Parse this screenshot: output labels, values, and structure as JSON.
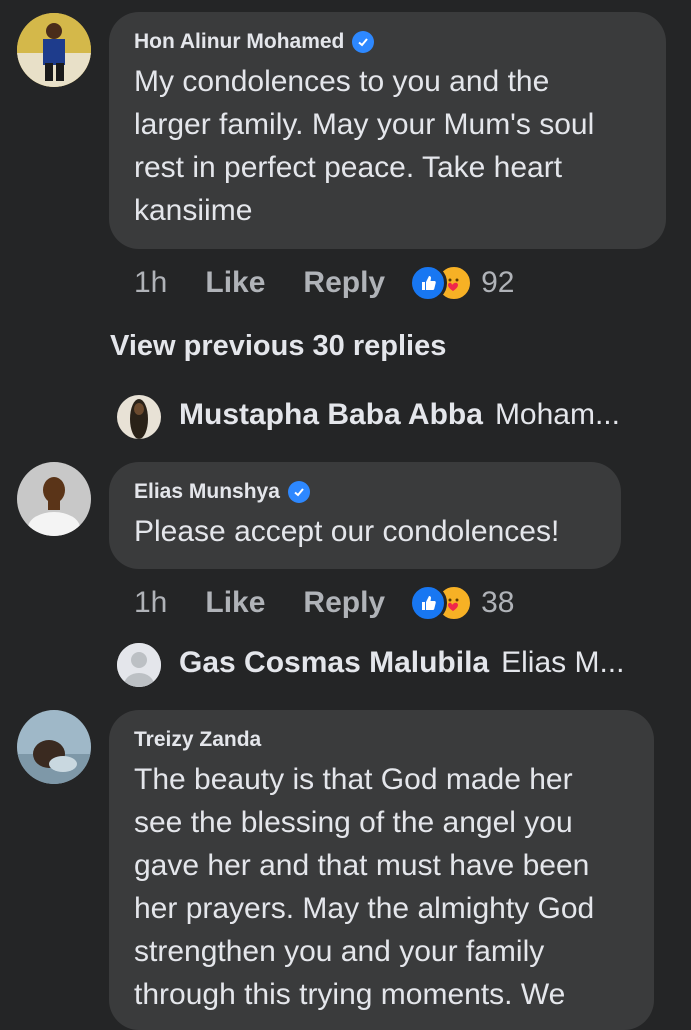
{
  "comments": [
    {
      "author": "Hon Alinur Mohamed",
      "verified": true,
      "text_lines": [
        "My condolences to you and the",
        "larger family. May your Mum's soul",
        "rest in perfect peace.  Take heart",
        "kansiime"
      ],
      "time": "1h",
      "like_label": "Like",
      "reply_label": "Reply",
      "reaction_count": "92"
    },
    {
      "author": "Elias Munshya",
      "verified": true,
      "text_lines": [
        "Please accept our condolences!"
      ],
      "time": "1h",
      "like_label": "Like",
      "reply_label": "Reply",
      "reaction_count": "38"
    },
    {
      "author": "Treizy Zanda",
      "verified": false,
      "text_lines": [
        "The beauty is that God made her",
        "see the blessing of the angel you",
        "gave her and that must have been",
        "her prayers. May the almighty God",
        "strengthen you and your family",
        "through this trying moments. We"
      ]
    }
  ],
  "view_previous": "View previous 30 replies",
  "replies": [
    {
      "author": "Mustapha Baba Abba",
      "preview": "Moham..."
    },
    {
      "author": "Gas Cosmas Malubila",
      "preview": "Elias M..."
    }
  ],
  "colors": {
    "background": "#242526",
    "bubble": "#3a3b3c",
    "verified": "#2d88ff",
    "like_reaction": "#1877f2",
    "care_reaction": "#f7b125",
    "secondary_text": "#b0b3b8"
  },
  "icons": [
    "verified-badge-icon",
    "like-reaction-icon",
    "care-reaction-icon"
  ]
}
